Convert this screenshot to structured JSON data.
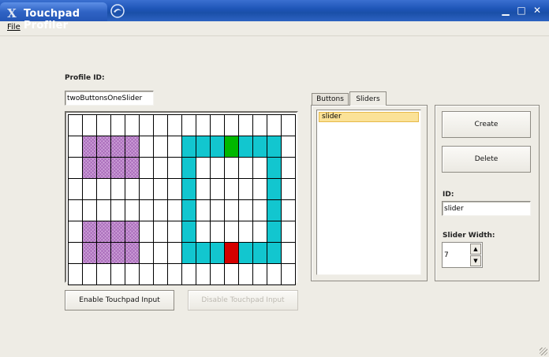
{
  "window": {
    "title": "Touchpad Profiler"
  },
  "menu": {
    "file_label": "File"
  },
  "profile": {
    "id_label": "Profile ID:",
    "id_value": "twoButtonsOneSlider"
  },
  "grid": {
    "cols": 16,
    "rows": 8,
    "pink": [
      [
        1,
        1
      ],
      [
        2,
        1
      ],
      [
        3,
        1
      ],
      [
        4,
        1
      ],
      [
        1,
        2
      ],
      [
        2,
        2
      ],
      [
        3,
        2
      ],
      [
        4,
        2
      ],
      [
        1,
        5
      ],
      [
        2,
        5
      ],
      [
        3,
        5
      ],
      [
        4,
        5
      ],
      [
        1,
        6
      ],
      [
        2,
        6
      ],
      [
        3,
        6
      ],
      [
        4,
        6
      ]
    ],
    "cyan": [
      [
        8,
        1
      ],
      [
        9,
        1
      ],
      [
        10,
        1
      ],
      [
        12,
        1
      ],
      [
        13,
        1
      ],
      [
        14,
        1
      ],
      [
        8,
        2
      ],
      [
        14,
        2
      ],
      [
        8,
        3
      ],
      [
        14,
        3
      ],
      [
        8,
        4
      ],
      [
        14,
        4
      ],
      [
        8,
        5
      ],
      [
        14,
        5
      ],
      [
        8,
        6
      ],
      [
        9,
        6
      ],
      [
        10,
        6
      ],
      [
        12,
        6
      ],
      [
        13,
        6
      ],
      [
        14,
        6
      ]
    ],
    "green": [
      [
        11,
        1
      ]
    ],
    "red": [
      [
        11,
        6
      ]
    ]
  },
  "buttons": {
    "enable": "Enable Touchpad Input",
    "disable": "Disable Touchpad Input",
    "create": "Create",
    "delete": "Delete"
  },
  "tabs": {
    "buttons": "Buttons",
    "sliders": "Sliders"
  },
  "list": {
    "items": [
      "slider"
    ]
  },
  "details": {
    "id_label": "ID:",
    "id_value": "slider",
    "width_label": "Slider Width:",
    "width_value": "7"
  },
  "colors": {
    "pink": "#cda0d8",
    "cyan": "#12c6cf",
    "green": "#00b800",
    "red": "#d40000",
    "selection": "#fbe297"
  }
}
